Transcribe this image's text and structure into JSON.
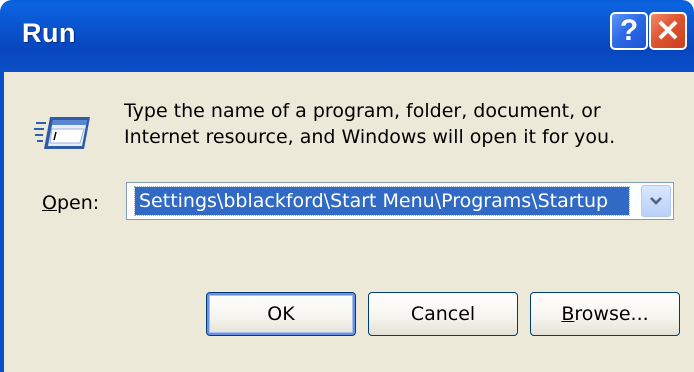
{
  "window": {
    "title": "Run",
    "help_glyph": "?",
    "close_glyph": "✕"
  },
  "body": {
    "description": "Type the name of a program, folder, document, or Internet resource, and Windows will open it for you.",
    "open_label_mnemonic": "O",
    "open_label_rest": "pen:",
    "open_value": "Settings\\bblackford\\Start Menu\\Programs\\Startup"
  },
  "buttons": {
    "ok": "OK",
    "cancel": "Cancel",
    "browse_mnemonic": "B",
    "browse_rest": "rowse..."
  },
  "colors": {
    "titlebar": "#0a55d0",
    "dialog_bg": "#ece9d8",
    "selection": "#316ac5"
  },
  "icons": {
    "run": "run-program-icon",
    "help": "help-icon",
    "close": "close-icon",
    "dropdown": "chevron-down-icon"
  }
}
